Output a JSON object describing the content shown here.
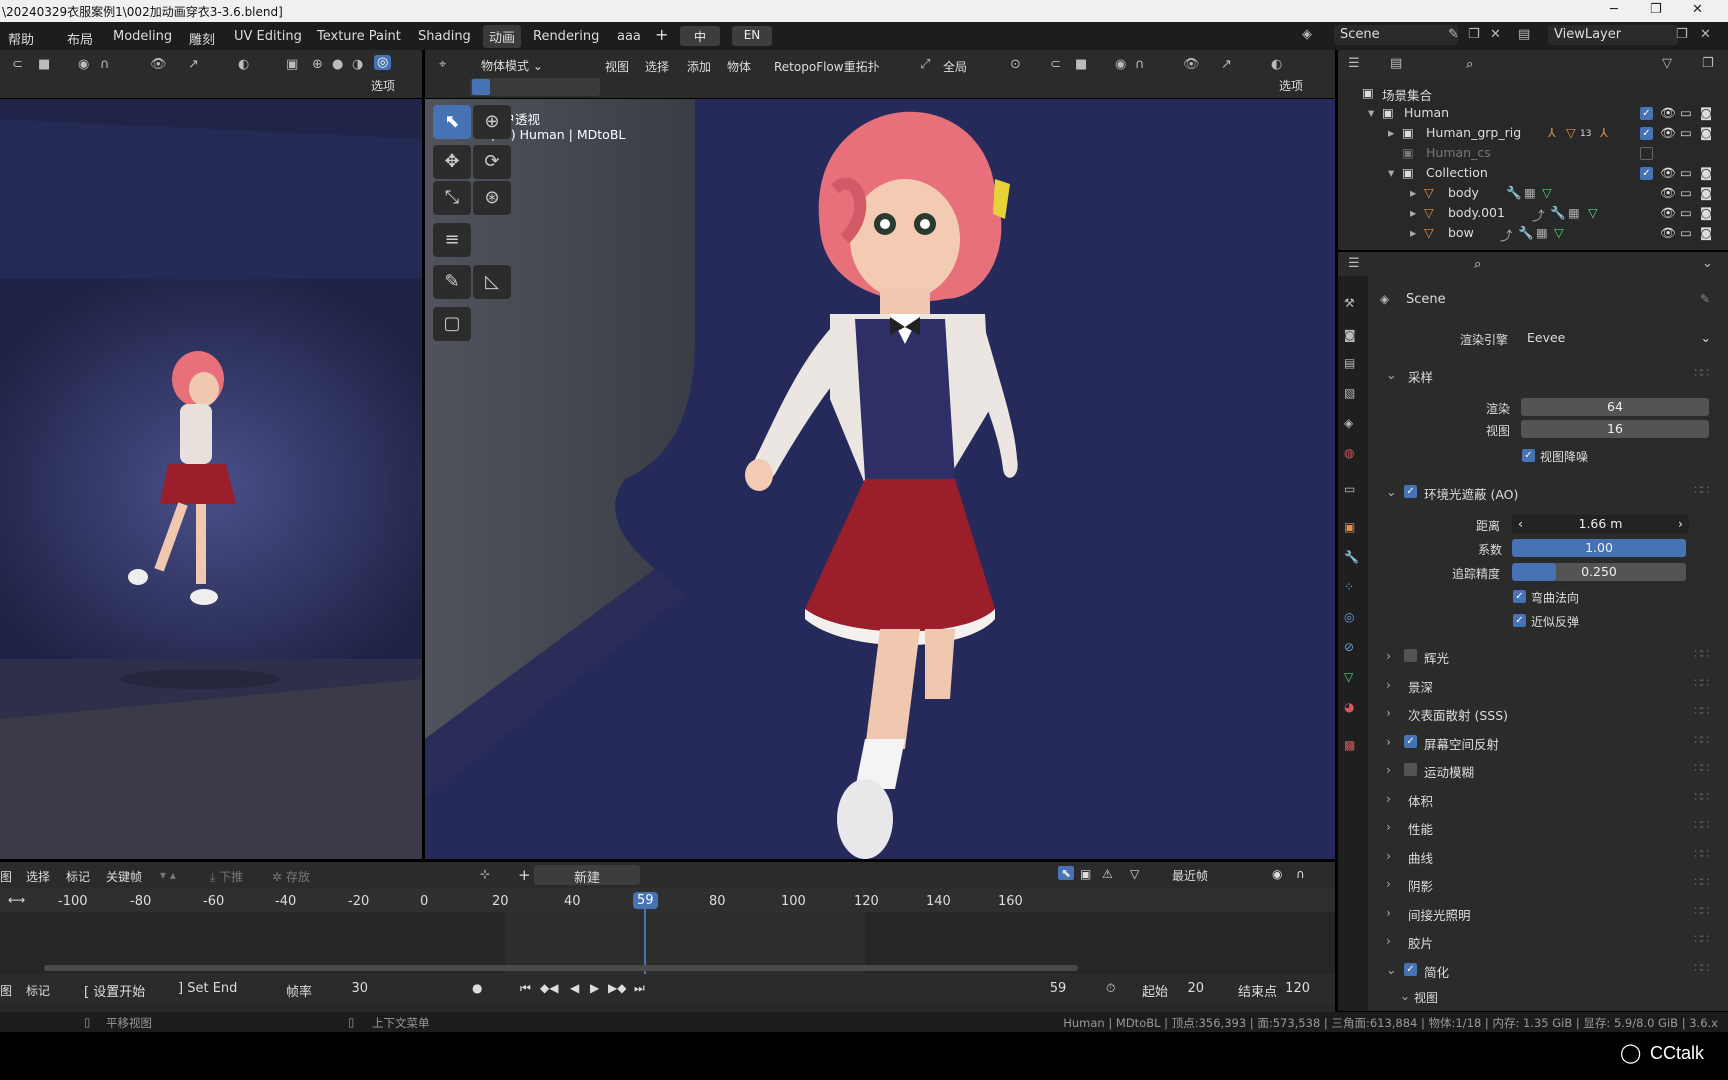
{
  "window": {
    "title": "\\20240329衣服案例1\\002加动画穿衣3-3.6.blend]"
  },
  "topbar": {
    "help": "帮助",
    "workspaces": [
      "布局",
      "Modeling",
      "雕刻",
      "UV Editing",
      "Texture Paint",
      "Shading",
      "动画",
      "Rendering",
      "aaa"
    ],
    "active_workspace": "动画",
    "add": "+",
    "lang_cn": "中",
    "lang_en": "EN",
    "scene_label": "Scene",
    "viewlayer_label": "ViewLayer"
  },
  "left_view": {
    "options": "选项"
  },
  "main_view": {
    "mode": "物体模式",
    "menus": [
      "视图",
      "选择",
      "添加",
      "物体"
    ],
    "addon": "RetopoFlow重拓扑",
    "transform_orientation": "全局",
    "options": "选项",
    "view_name": "用户透视",
    "object_info": "(59) Human | MDtoBL"
  },
  "outliner": {
    "rows": [
      {
        "label": "场景集合",
        "indent": 0
      },
      {
        "label": "Human",
        "indent": 1
      },
      {
        "label": "Human_grp_rig",
        "indent": 2
      },
      {
        "label": "Human_cs",
        "indent": 2,
        "dim": true
      },
      {
        "label": "Collection",
        "indent": 2
      },
      {
        "label": "body",
        "indent": 3
      },
      {
        "label": "body.001",
        "indent": 3
      },
      {
        "label": "bow",
        "indent": 3
      }
    ],
    "badge": "13"
  },
  "properties": {
    "context": "Scene",
    "render_engine_label": "渲染引擎",
    "render_engine_value": "Eevee",
    "sampling": {
      "title": "采样",
      "render_label": "渲染",
      "render_value": "64",
      "viewport_label": "视图",
      "viewport_value": "16",
      "denoise_label": "视图降噪"
    },
    "ao": {
      "title": "环境光遮蔽 (AO)",
      "distance_label": "距离",
      "distance_value": "1.66 m",
      "factor_label": "系数",
      "factor_value": "1.00",
      "factor_fill": 1.0,
      "precision_label": "追踪精度",
      "precision_value": "0.250",
      "precision_fill": 0.25,
      "bent_normals": "弯曲法向",
      "bounce": "近似反弹"
    },
    "sections": [
      "辉光",
      "景深",
      "次表面散射 (SSS)",
      "屏幕空间反射",
      "运动模糊",
      "体积",
      "性能",
      "曲线",
      "阴影",
      "间接光照明",
      "胶片",
      "简化"
    ],
    "sections_checked": {
      "辉光": false,
      "屏幕空间反射": true,
      "运动模糊": false,
      "简化": true
    },
    "subsection": "视图"
  },
  "timeline": {
    "header_menus": [
      "图",
      "选择",
      "标记",
      "关键帧"
    ],
    "push_down": "下推",
    "stash": "存放",
    "new": "新建",
    "snap": "最近帧",
    "ticks": [
      "-100",
      "-80",
      "-60",
      "-40",
      "-20",
      "0",
      "20",
      "40",
      "59",
      "80",
      "100",
      "120",
      "140",
      "160"
    ],
    "current_frame": "59",
    "footer": {
      "view": "图",
      "marker": "标记",
      "set_start": "设置开始",
      "set_end": "Set End",
      "fps_label": "帧率",
      "fps_value": "30",
      "frame_value": "59",
      "start_label": "起始",
      "start_value": "20",
      "end_label": "结束点",
      "end_value": "120"
    }
  },
  "status": {
    "left": "平移视图",
    "mid": "上下文菜单",
    "right": "Human | MDtoBL | 顶点:356,393 | 面:573,538 | 三角面:613,884 | 物体:1/18 | 内存: 1.35 GiB | 显存: 5.9/8.0 GiB | 3.6.x"
  },
  "watermark": "CCtalk"
}
